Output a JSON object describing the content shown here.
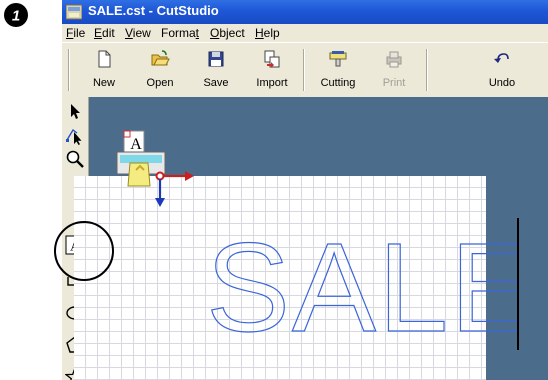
{
  "step_number": "❶",
  "window": {
    "title": "SALE.cst - CutStudio"
  },
  "menu": [
    {
      "label": "File",
      "underline": "F",
      "rest": "ile"
    },
    {
      "label": "Edit",
      "underline": "E",
      "rest": "dit"
    },
    {
      "label": "View",
      "underline": "V",
      "rest": "iew"
    },
    {
      "label": "Format",
      "pre": "Forma",
      "underline": "t",
      "rest": ""
    },
    {
      "label": "Object",
      "underline": "O",
      "rest": "bject"
    },
    {
      "label": "Help",
      "underline": "H",
      "rest": "elp"
    }
  ],
  "toolbar": {
    "buttons": [
      {
        "label": "New",
        "icon": "new-document-icon",
        "disabled": false
      },
      {
        "label": "Open",
        "icon": "open-folder-icon",
        "disabled": false
      },
      {
        "label": "Save",
        "icon": "floppy-disk-icon",
        "disabled": false
      },
      {
        "label": "Import",
        "icon": "import-icon",
        "disabled": false
      },
      {
        "label": "Cutting",
        "icon": "cutting-machine-icon",
        "disabled": false
      },
      {
        "label": "Print",
        "icon": "printer-icon",
        "disabled": true
      },
      {
        "label": "Undo",
        "icon": "undo-icon",
        "disabled": false
      }
    ]
  },
  "sidebar": {
    "tools": [
      "select-arrow-icon",
      "edit-points-icon",
      "zoom-icon",
      "text-tool-icon",
      "rectangle-icon",
      "ellipse-icon",
      "polygon-icon",
      "star-icon"
    ]
  },
  "canvas": {
    "outline_text": "SALE",
    "outline_color": "#3a66d8"
  },
  "colors": {
    "titlebar": "#1f57d6",
    "menubar": "#ece9d8",
    "canvas_bg": "#4c6c8c"
  }
}
